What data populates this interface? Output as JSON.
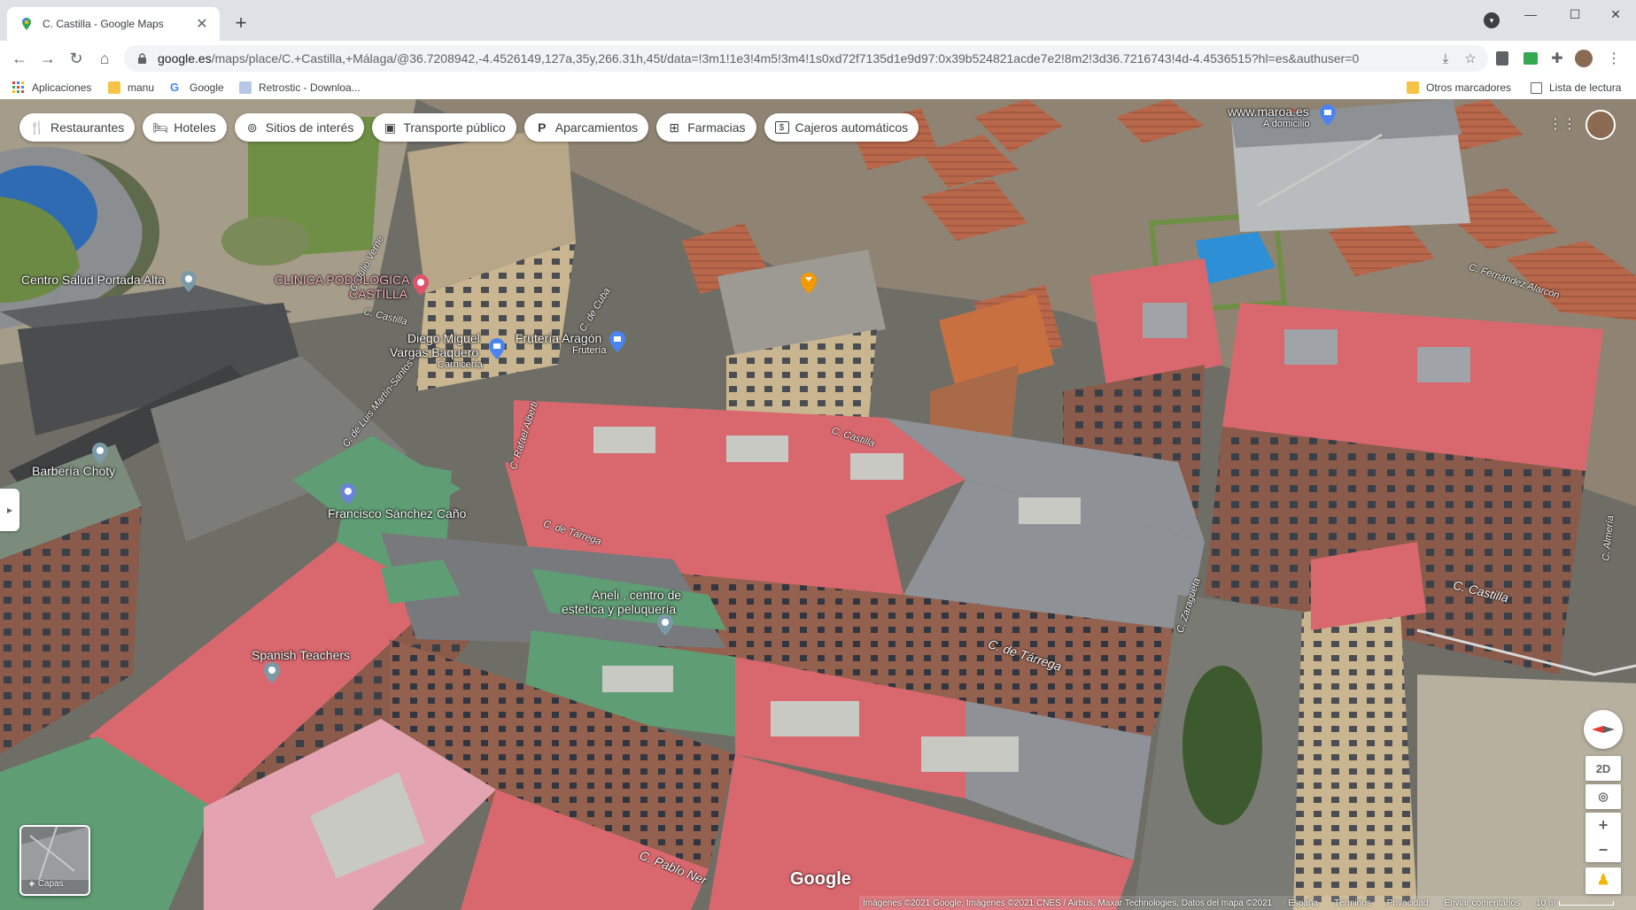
{
  "browser": {
    "tab_title": "C. Castilla - Google Maps",
    "tab_close": "✕",
    "new_tab": "+",
    "url_host": "google.es",
    "url_rest": "/maps/place/C.+Castilla,+Málaga/@36.7208942,-4.4526149,127a,35y,266.31h,45t/data=!3m1!1e3!4m5!3m4!1s0xd72f7135d1e9d97:0x39b524821acde7e2!8m2!3d36.7216743!4d-4.4536515?hl=es&authuser=0",
    "bookmarks": [
      {
        "label": "Aplicaciones",
        "icon": "apps-grid-icon"
      },
      {
        "label": "manu",
        "icon": "folder-icon"
      },
      {
        "label": "Google",
        "icon": "google-icon"
      },
      {
        "label": "Retrostic - Downloa...",
        "icon": "retrostic-icon"
      }
    ],
    "other_bookmarks": "Otros marcadores",
    "reading_list": "Lista de lectura"
  },
  "map": {
    "chips": [
      {
        "label": "Restaurantes",
        "icon": "restaurant-icon",
        "glyph": "🍴"
      },
      {
        "label": "Hoteles",
        "icon": "hotel-icon",
        "glyph": "🛏"
      },
      {
        "label": "Sitios de interés",
        "icon": "camera-icon",
        "glyph": "⊚"
      },
      {
        "label": "Transporte público",
        "icon": "bus-icon",
        "glyph": "▣"
      },
      {
        "label": "Aparcamientos",
        "icon": "parking-icon",
        "glyph": "P"
      },
      {
        "label": "Farmacias",
        "icon": "pharmacy-icon",
        "glyph": "⊞"
      },
      {
        "label": "Cajeros automáticos",
        "icon": "atm-icon",
        "glyph": "$"
      }
    ],
    "places": {
      "centro_salud": "Centro Salud Portada Alta",
      "clinica_1": "CLINICA PODOLOGICA",
      "clinica_2": "CASTILLA",
      "diego_1": "Diego Miguel",
      "diego_2": "Vargas Baquero",
      "diego_sub": "Carnicería",
      "fruteria": "Frutería Aragón",
      "fruteria_sub": "Frutería",
      "maroa": "www.maroa.es",
      "maroa_sub": "A domicilio",
      "barberia": "Barbería Choty",
      "francisco": "Francisco Sánchez Caño",
      "aneli_1": "Aneli , centro de",
      "aneli_2": "estetica y peluquería",
      "spanish": "Spanish Teachers"
    },
    "streets": {
      "castilla_1": "C. Castilla",
      "castilla_2": "C. Castilla",
      "castilla_3": "C. Castilla",
      "tarrega_1": "C. de Tárrega",
      "tarrega_2": "C. de Tárrega",
      "zaragueta": "C. Zaragueta",
      "rafael_alberti": "C. Rafael Alberti",
      "luis_martin": "C. de Luis Martín-Santos",
      "pablo": "C. Pablo Ner",
      "fernandez": "C. Fernández Alarcón",
      "julio_verne": "C. Julio Verne",
      "cuba": "C. de Cuba",
      "almeria": "C. Almería"
    },
    "layers_label": "Capas",
    "google_logo": "Google",
    "controls": {
      "two_d": "2D",
      "zoom_in": "+",
      "zoom_out": "−"
    },
    "attribution": {
      "imagery": "Imágenes ©2021 Google, Imágenes ©2021 CNES / Airbus, Maxar Technologies, Datos del mapa ©2021",
      "country": "España",
      "terms": "Términos",
      "privacy": "Privacidad",
      "feedback": "Enviar comentarios",
      "scale": "10 m"
    },
    "colors": {
      "roof_red": "#d9686e",
      "roof_green": "#5f9e74",
      "roof_gray": "#8e9296",
      "brick": "#8a5a4a",
      "accent": "#1a73e8"
    }
  }
}
